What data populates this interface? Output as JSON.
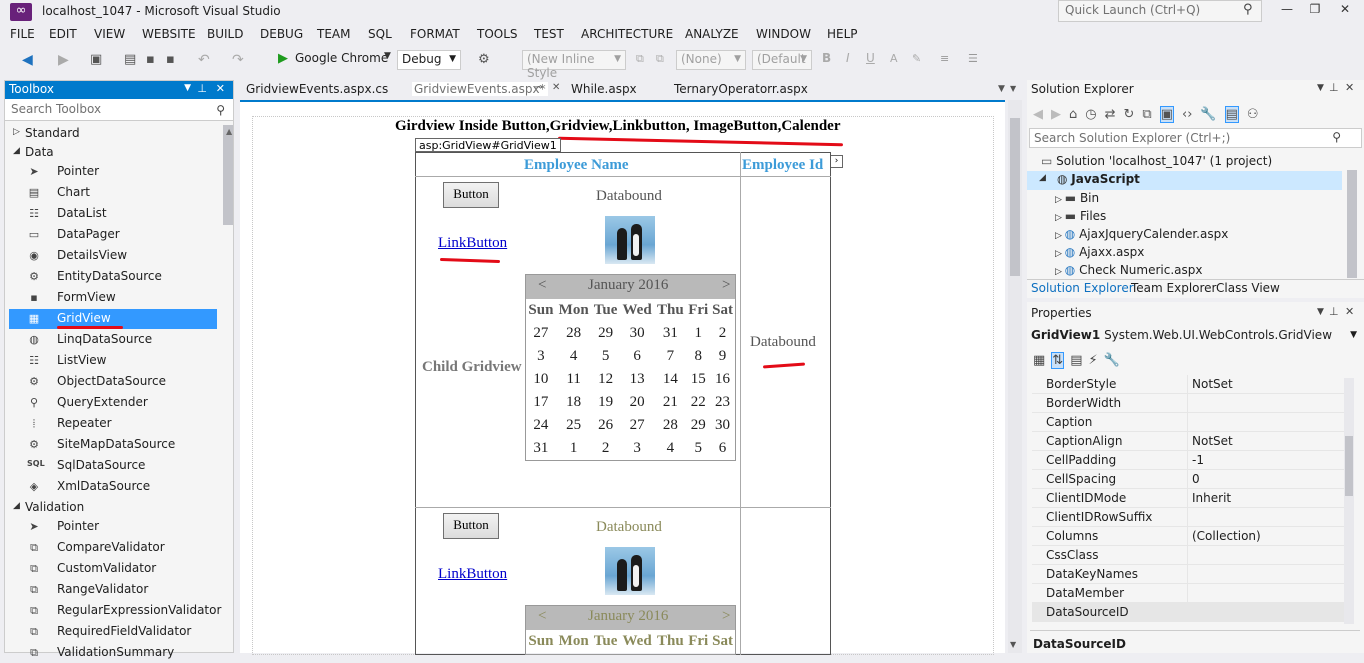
{
  "window": {
    "title": "localhost_1047 - Microsoft Visual Studio",
    "quick_launch": "Quick Launch (Ctrl+Q)"
  },
  "menu": [
    "FILE",
    "EDIT",
    "VIEW",
    "WEBSITE",
    "BUILD",
    "DEBUG",
    "TEAM",
    "SQL",
    "FORMAT",
    "TOOLS",
    "TEST",
    "ARCHITECTURE",
    "ANALYZE",
    "WINDOW",
    "HELP"
  ],
  "toolbar": {
    "browser": "Google Chrome",
    "config": "Debug",
    "style": "(New Inline Style",
    "target": "(None)",
    "font": "(Default"
  },
  "toolbox": {
    "title": "Toolbox",
    "search_placeholder": "Search Toolbox",
    "categories": [
      {
        "name": "Standard",
        "expanded": false
      },
      {
        "name": "Data",
        "expanded": true
      },
      {
        "name": "Validation",
        "expanded": true
      }
    ],
    "data_items": [
      "Pointer",
      "Chart",
      "DataList",
      "DataPager",
      "DetailsView",
      "EntityDataSource",
      "FormView",
      "GridView",
      "LinqDataSource",
      "ListView",
      "ObjectDataSource",
      "QueryExtender",
      "Repeater",
      "SiteMapDataSource",
      "SqlDataSource",
      "XmlDataSource"
    ],
    "validation_items": [
      "Pointer",
      "CompareValidator",
      "CustomValidator",
      "RangeValidator",
      "RegularExpressionValidator",
      "RequiredFieldValidator",
      "ValidationSummary"
    ],
    "selected": "GridView"
  },
  "tabs": [
    {
      "label": "GridviewEvents.aspx.cs",
      "active": false
    },
    {
      "label": "GridviewEvents.aspx*",
      "active": true
    },
    {
      "label": "While.aspx",
      "active": false
    },
    {
      "label": "TernaryOperatorr.aspx",
      "active": false
    }
  ],
  "designer": {
    "heading": "Girdview Inside Button,Gridview,Linkbutton, ImageButton,Calender",
    "tag": "asp:GridView#GridView1",
    "col_name": "Employee Name",
    "col_id": "Employee Id",
    "button": "Button",
    "databound": "Databound",
    "link": "LinkButton",
    "child": "Child Gridview",
    "calendar": {
      "prev": "<",
      "next": ">",
      "month": "January 2016",
      "days": [
        "Sun",
        "Mon",
        "Tue",
        "Wed",
        "Thu",
        "Fri",
        "Sat"
      ],
      "weeks": [
        [
          "27",
          "28",
          "29",
          "30",
          "31",
          "1",
          "2"
        ],
        [
          "3",
          "4",
          "5",
          "6",
          "7",
          "8",
          "9"
        ],
        [
          "10",
          "11",
          "12",
          "13",
          "14",
          "15",
          "16"
        ],
        [
          "17",
          "18",
          "19",
          "20",
          "21",
          "22",
          "23"
        ],
        [
          "24",
          "25",
          "26",
          "27",
          "28",
          "29",
          "30"
        ],
        [
          "31",
          "1",
          "2",
          "3",
          "4",
          "5",
          "6"
        ]
      ]
    }
  },
  "solution_explorer": {
    "title": "Solution Explorer",
    "search_placeholder": "Search Solution Explorer (Ctrl+;)",
    "solution": "Solution 'localhost_1047' (1 project)",
    "project": "JavaScript",
    "items": [
      "Bin",
      "Files",
      "AjaxJqueryCalender.aspx",
      "Ajaxx.aspx",
      "Check Numeric.aspx"
    ],
    "tabs": [
      "Solution Explorer",
      "Team Explorer",
      "Class View"
    ]
  },
  "properties": {
    "title": "Properties",
    "object": "GridView1",
    "object_type": "System.Web.UI.WebControls.GridView",
    "rows": [
      {
        "name": "BorderStyle",
        "value": "NotSet"
      },
      {
        "name": "BorderWidth",
        "value": ""
      },
      {
        "name": "Caption",
        "value": ""
      },
      {
        "name": "CaptionAlign",
        "value": "NotSet"
      },
      {
        "name": "CellPadding",
        "value": "-1"
      },
      {
        "name": "CellSpacing",
        "value": "0"
      },
      {
        "name": "ClientIDMode",
        "value": "Inherit"
      },
      {
        "name": "ClientIDRowSuffix",
        "value": ""
      },
      {
        "name": "Columns",
        "value": "(Collection)"
      },
      {
        "name": "CssClass",
        "value": ""
      },
      {
        "name": "DataKeyNames",
        "value": ""
      },
      {
        "name": "DataMember",
        "value": ""
      },
      {
        "name": "DataSourceID",
        "value": ""
      }
    ],
    "footer": "DataSourceID"
  },
  "colors": {
    "accent": "#007acc",
    "link_blue": "#3c9bd8",
    "red_mark": "#e30b17",
    "calendar_header": "#b9b9b9"
  }
}
